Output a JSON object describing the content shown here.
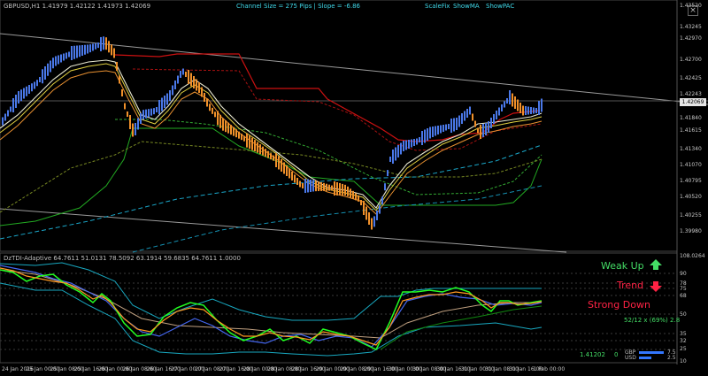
{
  "symbol_info": "GBPUSD,H1  1.41979 1.42122 1.41973 1.42069",
  "channel_info": "Channel Size = 275 Pips  |  Slope = -6.86",
  "toolbar": [
    "ScaleFix",
    "ShowMA",
    "ShowPAC"
  ],
  "close_glyph": "×",
  "current_price": "1.42069",
  "price_axis": [
    "1.43520",
    "1.43245",
    "1.42970",
    "1.42700",
    "1.42425",
    "1.42243",
    "1.42115",
    "1.41840",
    "1.41615",
    "1.41340",
    "1.41070",
    "1.40795",
    "1.40520",
    "1.40255",
    "1.39980"
  ],
  "indicator_title": "DzTDI-Adaptive 64.7611 51.0131 78.5092 63.1914 59.6835 64.7611 1.0000",
  "indicator_axis": [
    "108.0264",
    "90",
    "78",
    "75",
    "68",
    "65",
    "50",
    "35",
    "32",
    "25",
    "15",
    "10",
    "-8.0264"
  ],
  "signals": {
    "weak_up_label": "Weak Up",
    "trend_label": "Trend",
    "strong_down_label": "Strong Down",
    "weak_up_color": "#44dd66",
    "trend_color": "#ff2244",
    "strong_down_color": "#ff2244"
  },
  "strength": "52/12 x (69%) 2.8",
  "bottom_price": "1.41202",
  "bottom_zero": "0",
  "currency_strength": [
    {
      "name": "GBP",
      "value": "7.5"
    },
    {
      "name": "USD",
      "value": "2.5"
    }
  ],
  "time_axis": [
    "24 Jan 2016",
    "25 Jan 00:00",
    "25 Jan 08:00",
    "25 Jan 16:00",
    "26 Jan 00:00",
    "26 Jan 08:00",
    "26 Jan 16:00",
    "27 Jan 00:00",
    "27 Jan 08:00",
    "27 Jan 16:00",
    "28 Jan 00:00",
    "28 Jan 08:00",
    "28 Jan 16:00",
    "29 Jan 00:00",
    "29 Jan 08:00",
    "29 Jan 16:00",
    "30 Jan 00:00",
    "30 Jan 08:00",
    "30 Jan 16:00",
    "31 Jan 00:00",
    "31 Jan 08:00",
    "31 Jan 16:00",
    "1 Feb 00:00"
  ]
}
